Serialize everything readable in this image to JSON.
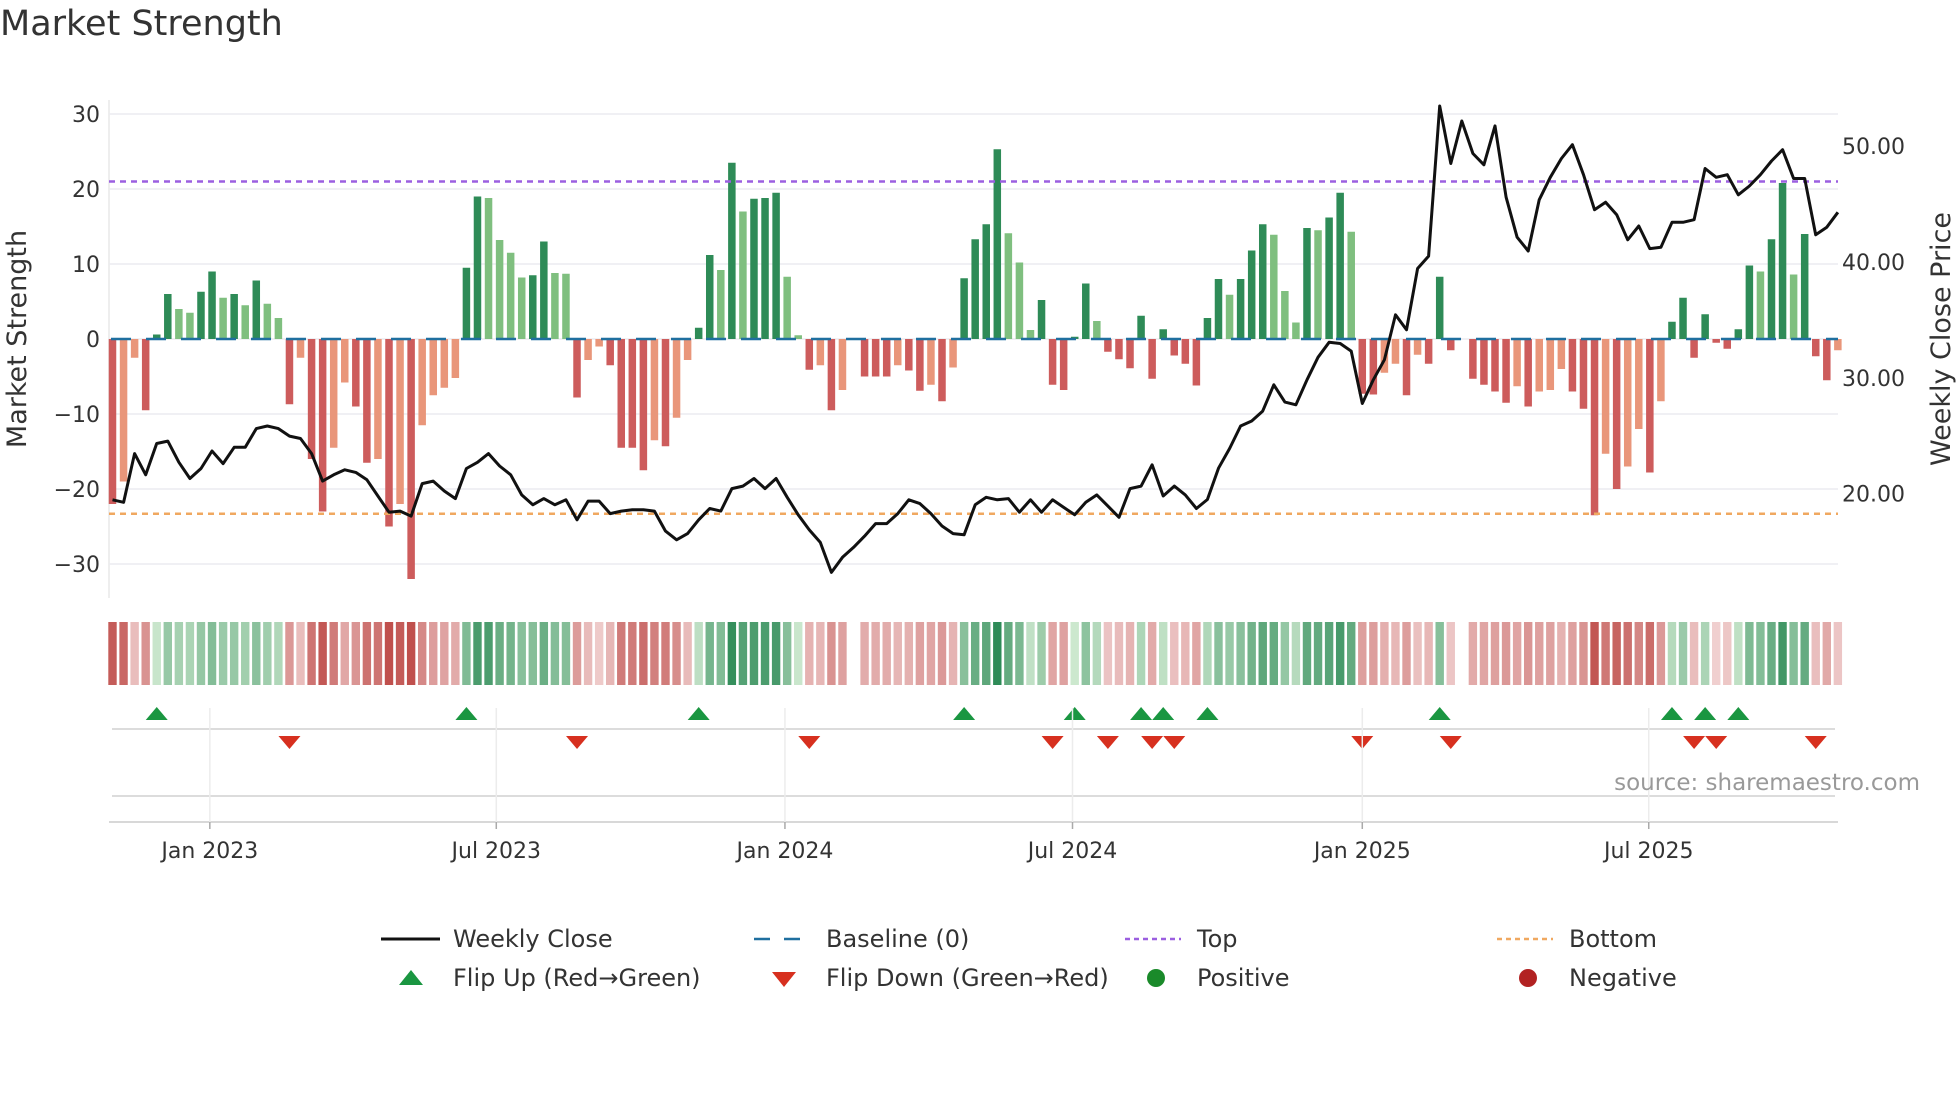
{
  "title": "Market Strength",
  "source": "source: sharemaestro.com",
  "colors": {
    "pos_strong": "#2e8b57",
    "pos_weak": "#7fbf7f",
    "neg_strong": "#cd5c5c",
    "neg_weak": "#e9967a",
    "baseline": "#1f6f9f",
    "top": "#9b5fe0",
    "bottom": "#f0a860",
    "close": "#111111",
    "flip_up": "#1a9641",
    "flip_down": "#d7301f",
    "positive_dot": "#1a8a2a",
    "negative_dot": "#b22222"
  },
  "legend": {
    "weekly_close": "Weekly Close",
    "baseline": "Baseline (0)",
    "top": "Top",
    "bottom": "Bottom",
    "flip_up": "Flip Up (Red→Green)",
    "flip_down": "Flip Down (Green→Red)",
    "positive": "Positive",
    "negative": "Negative"
  },
  "chart_data": {
    "type": "bar+line",
    "title": "Market Strength",
    "ylabel": "Market Strength",
    "y2label": "Weekly Close Price",
    "ylim": [
      -34.5,
      31.8
    ],
    "y2lim": [
      11.05,
      54.0
    ],
    "yticks": [
      {
        "v": 30,
        "label": "30"
      },
      {
        "v": 20,
        "label": "20"
      },
      {
        "v": 10,
        "label": "10"
      },
      {
        "v": 0,
        "label": "0"
      },
      {
        "v": -10,
        "label": "−10"
      },
      {
        "v": -20,
        "label": "−20"
      },
      {
        "v": -30,
        "label": "−30"
      }
    ],
    "y2ticks": [
      {
        "v": 50,
        "label": "50.00"
      },
      {
        "v": 40,
        "label": "40.00"
      },
      {
        "v": 30,
        "label": "30.00"
      },
      {
        "v": 20,
        "label": "20.00"
      }
    ],
    "xticks": [
      {
        "week": 8.8,
        "label": "Jan 2023"
      },
      {
        "week": 34.7,
        "label": "Jul 2023"
      },
      {
        "week": 60.8,
        "label": "Jan 2024"
      },
      {
        "week": 86.8,
        "label": "Jul 2024"
      },
      {
        "week": 113.0,
        "label": "Jan 2025"
      },
      {
        "week": 138.9,
        "label": "Jul 2025"
      }
    ],
    "top_level": 21,
    "bottom_level": -23.3,
    "baseline": 0,
    "strength": [
      -22,
      -19,
      -2.5,
      -9.5,
      0.6,
      6,
      4,
      3.5,
      6.3,
      9,
      5.5,
      6,
      4.5,
      7.8,
      4.7,
      2.8,
      -8.7,
      -2.5,
      -16,
      -23,
      -14.5,
      -5.8,
      -9,
      -16.5,
      -16,
      -25,
      -22,
      -32,
      -11.5,
      -7.5,
      -6.5,
      -5.2,
      9.5,
      19,
      18.8,
      13.2,
      11.5,
      8.2,
      8.5,
      13,
      8.8,
      8.7,
      -7.8,
      -2.8,
      -1,
      -3.5,
      -14.5,
      -14.5,
      -17.5,
      -13.5,
      -14.3,
      -10.5,
      -2.8,
      1.5,
      11.2,
      9.2,
      23.5,
      17,
      18.7,
      18.8,
      19.5,
      8.3,
      0.5,
      -4.1,
      -3.5,
      -9.5,
      -6.8,
      0,
      -5,
      -5,
      -5,
      -3.5,
      -4.2,
      -6.9,
      -6.1,
      -8.3,
      -3.8,
      8.1,
      13.3,
      15.3,
      25.3,
      14.1,
      10.2,
      1.2,
      5.2,
      -6.1,
      -6.8,
      0.3,
      7.4,
      2.4,
      -1.7,
      -2.7,
      -3.9,
      3.1,
      -5.3,
      1.3,
      -2.2,
      -3.3,
      -6.2,
      2.8,
      8,
      5.9,
      8,
      11.8,
      15.3,
      13.9,
      6.4,
      2.2,
      14.8,
      14.5,
      16.2,
      19.5,
      14.3,
      -7.3,
      -7.4,
      -4.5,
      -3.3,
      -7.5,
      -2.1,
      -3.3,
      8.3,
      -1.5,
      0,
      -5.3,
      -6.1,
      -7,
      -8.5,
      -6.3,
      -9,
      -7,
      -6.8,
      -4,
      -7,
      -9.3,
      -23.5,
      -15.3,
      -20,
      -17,
      -12,
      -17.8,
      -8.3,
      2.3,
      5.5,
      -2.5,
      3.3,
      -0.5,
      -1.3,
      1.3,
      9.8,
      9,
      13.3,
      20.8,
      8.6,
      14,
      -2.3,
      -5.5,
      -1.5
    ],
    "close": [
      19.47,
      19.26,
      23.46,
      21.63,
      24.33,
      24.54,
      22.71,
      21.31,
      22.17,
      23.68,
      22.6,
      24.0,
      24.0,
      25.62,
      25.84,
      25.62,
      24.97,
      24.76,
      23.46,
      21.09,
      21.63,
      22.06,
      21.84,
      21.2,
      19.8,
      18.4,
      18.5,
      18.07,
      20.87,
      21.09,
      20.23,
      19.58,
      22.17,
      22.71,
      23.46,
      22.39,
      21.63,
      19.9,
      19.04,
      19.58,
      19.04,
      19.47,
      17.75,
      19.36,
      19.36,
      18.28,
      18.5,
      18.61,
      18.61,
      18.5,
      16.77,
      16.02,
      16.56,
      17.75,
      18.72,
      18.5,
      20.44,
      20.66,
      21.31,
      20.44,
      21.31,
      19.69,
      18.18,
      16.88,
      15.8,
      13.21,
      14.51,
      15.37,
      16.34,
      17.42,
      17.42,
      18.28,
      19.47,
      19.15,
      18.28,
      17.21,
      16.56,
      16.45,
      19.04,
      19.69,
      19.47,
      19.58,
      18.4,
      19.47,
      18.4,
      19.47,
      18.82,
      18.18,
      19.26,
      19.9,
      18.93,
      17.96,
      20.44,
      20.66,
      22.49,
      19.8,
      20.66,
      19.9,
      18.72,
      19.5,
      22.2,
      23.9,
      25.84,
      26.27,
      27.13,
      29.4,
      27.9,
      27.67,
      29.83,
      31.77,
      33.06,
      32.96,
      32.3,
      27.78,
      29.83,
      31.55,
      35.44,
      34.14,
      39.43,
      40.5,
      53.45,
      48.49,
      52.16,
      49.35,
      48.38,
      51.73,
      45.58,
      42.13,
      40.94,
      45.36,
      47.3,
      48.92,
      50.11,
      47.52,
      44.5,
      45.15,
      44.07,
      41.91,
      43.1,
      41.15,
      41.26,
      43.42,
      43.42,
      43.64,
      48.06,
      47.3,
      47.52,
      45.79,
      46.55,
      47.52,
      48.71,
      49.68,
      47.2,
      47.2,
      42.34,
      42.99,
      44.28
    ]
  }
}
